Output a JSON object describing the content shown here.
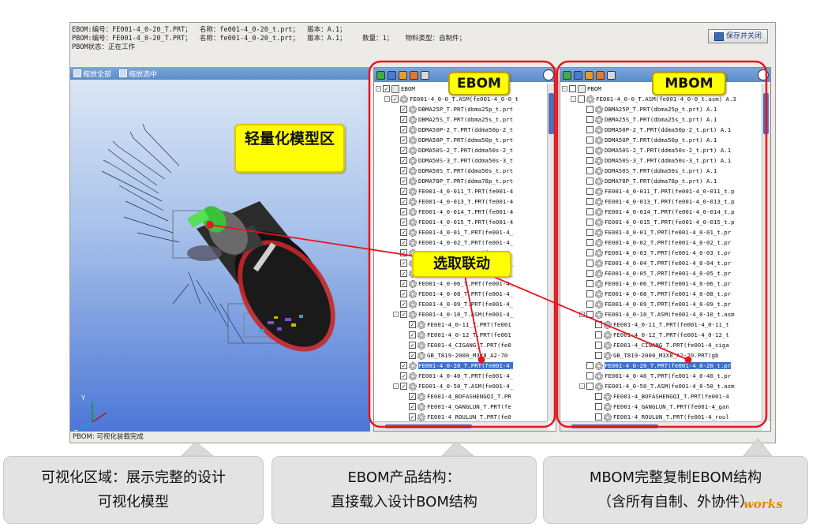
{
  "info": {
    "line1": "EBOM:编号：FE001-4_0-20_T.PRT；  名称：fe001-4_0-20_t.prt；  版本：A.1；",
    "line2": "PBOM:编号：FE001-4_0-20_T.PRT；  名称：fe001-4_0-20_t.prt；  版本：A.1；    数量：1；   物料类型：自制件；",
    "line3": "PBOM状态：正在工作",
    "save_button": "保存并关闭"
  },
  "viewer": {
    "zoom_all": "缩放全部",
    "zoom_selected": "缩放选中",
    "status": "PBOM: 可视化装载完成",
    "axis_y": "Y",
    "axis_z": "Z"
  },
  "callouts": {
    "model_area": "轻量化模型区",
    "ebom": "EBOM",
    "mbom": "MBOM",
    "selection_link": "选取联动"
  },
  "ebom_tree": [
    {
      "indent": 0,
      "exp": "-",
      "checked": true,
      "icon": "folder",
      "text": "EBOM"
    },
    {
      "indent": 1,
      "exp": "-",
      "checked": true,
      "icon": "gear",
      "text": "FE001-4_0-0_T.ASM(fe001-4_0-0_t"
    },
    {
      "indent": 2,
      "exp": "",
      "checked": true,
      "icon": "gear",
      "text": "DBMA25P_T.PRT(dbma25p_t.prt"
    },
    {
      "indent": 2,
      "exp": "",
      "checked": true,
      "icon": "gear",
      "text": "DBMA25S_T.PRT(dbma25s_t.prt"
    },
    {
      "indent": 2,
      "exp": "",
      "checked": true,
      "icon": "gear",
      "text": "DDMA50P-2_T.PRT(ddma50p-2_t"
    },
    {
      "indent": 2,
      "exp": "",
      "checked": true,
      "icon": "gear",
      "text": "DDMA50P_T.PRT(ddma50p_t.prt"
    },
    {
      "indent": 2,
      "exp": "",
      "checked": true,
      "icon": "gear",
      "text": "DDMA50S-2_T.PRT(ddma50s-2_t"
    },
    {
      "indent": 2,
      "exp": "",
      "checked": true,
      "icon": "gear",
      "text": "DDMA50S-3_T.PRT(ddma50s-3_t"
    },
    {
      "indent": 2,
      "exp": "",
      "checked": true,
      "icon": "gear",
      "text": "DDMA50S_T.PRT(ddma50s_t.prt"
    },
    {
      "indent": 2,
      "exp": "",
      "checked": true,
      "icon": "gear",
      "text": "DDMA78P_T.PRT(ddma78p_t.prt"
    },
    {
      "indent": 2,
      "exp": "",
      "checked": true,
      "icon": "gear",
      "text": "FE001-4_0-011_T.PRT(fe001-4"
    },
    {
      "indent": 2,
      "exp": "",
      "checked": true,
      "icon": "gear",
      "text": "FE001-4_0-013_T.PRT(fe001-4"
    },
    {
      "indent": 2,
      "exp": "",
      "checked": true,
      "icon": "gear",
      "text": "FE001-4_0-014_T.PRT(fe001-4"
    },
    {
      "indent": 2,
      "exp": "",
      "checked": true,
      "icon": "gear",
      "text": "FE001-4_0-015_T.PRT(fe001-4"
    },
    {
      "indent": 2,
      "exp": "",
      "checked": true,
      "icon": "gear",
      "text": "FE001-4_0-01_T.PRT(fe001-4_"
    },
    {
      "indent": 2,
      "exp": "",
      "checked": true,
      "icon": "gear",
      "text": "FE001-4_0-02_T.PRT(fe001-4_"
    },
    {
      "indent": 2,
      "exp": "",
      "checked": true,
      "icon": "gear",
      "text": "FE001-4_0-03_T.PRT(fe001-4_"
    },
    {
      "indent": 2,
      "exp": "",
      "checked": true,
      "icon": "gear",
      "text": "FE001-4_0-04_T.PRT(fe001-4_"
    },
    {
      "indent": 2,
      "exp": "",
      "checked": true,
      "icon": "gear",
      "text": "FE001-4_0-05_T.PRT(fe001-4_"
    },
    {
      "indent": 2,
      "exp": "",
      "checked": true,
      "icon": "gear",
      "text": "FE001-4_0-06_T.PRT(fe001-4_"
    },
    {
      "indent": 2,
      "exp": "",
      "checked": true,
      "icon": "gear",
      "text": "FE001-4_0-08_T.PRT(fe001-4_"
    },
    {
      "indent": 2,
      "exp": "",
      "checked": true,
      "icon": "gear",
      "text": "FE001-4_0-09_T.PRT(fe001-4_"
    },
    {
      "indent": 2,
      "exp": "-",
      "checked": true,
      "icon": "gear",
      "text": "FE001-4_0-10_T.ASM(fe001-4_"
    },
    {
      "indent": 3,
      "exp": "",
      "checked": true,
      "icon": "gear",
      "text": "FE001-4_0-11_T.PRT(fe001"
    },
    {
      "indent": 3,
      "exp": "",
      "checked": true,
      "icon": "gear",
      "text": "FE001-4_0-12_T.PRT(fe001"
    },
    {
      "indent": 3,
      "exp": "",
      "checked": true,
      "icon": "gear",
      "text": "FE001-4_CIGANG_T.PRT(fe0"
    },
    {
      "indent": 3,
      "exp": "",
      "checked": true,
      "icon": "gear",
      "text": "GB_T819-2000_M3X8_A2-70"
    },
    {
      "indent": 2,
      "exp": "",
      "checked": true,
      "icon": "gear",
      "text": "FE001-4_0-20_T.PRT(fe001-4_",
      "selected": true
    },
    {
      "indent": 2,
      "exp": "",
      "checked": true,
      "icon": "gear",
      "text": "FE001-4_0-40_T.PRT(fe001-4_"
    },
    {
      "indent": 2,
      "exp": "-",
      "checked": true,
      "icon": "gear",
      "text": "FE001-4_0-50_T.ASM(fe001-4_"
    },
    {
      "indent": 3,
      "exp": "",
      "checked": true,
      "icon": "gear",
      "text": "FE001-4_BOFASHENGQI_T.PR"
    },
    {
      "indent": 3,
      "exp": "",
      "checked": true,
      "icon": "gear",
      "text": "FE001-4_GANGLUN_T.PRT(fe"
    },
    {
      "indent": 3,
      "exp": "",
      "checked": true,
      "icon": "gear",
      "text": "FE001-4_ROULUN_T.PRT(fe0"
    }
  ],
  "mbom_tree": [
    {
      "indent": 0,
      "exp": "-",
      "checked": false,
      "icon": "folder",
      "text": "PBOM"
    },
    {
      "indent": 1,
      "exp": "-",
      "checked": false,
      "icon": "gear",
      "text": "FE001-4_0-0_T.ASM(fe001-4_0-0_t.asm) A.3"
    },
    {
      "indent": 2,
      "exp": "",
      "checked": false,
      "icon": "gear",
      "text": "DBMA25P_T.PRT(dbma25p_t.prt) A.1"
    },
    {
      "indent": 2,
      "exp": "",
      "checked": false,
      "icon": "gear",
      "text": "DBMA25S_T.PRT(dbma25s_t.prt) A.1"
    },
    {
      "indent": 2,
      "exp": "",
      "checked": false,
      "icon": "gear",
      "text": "DDMA50P-2_T.PRT(ddma50p-2_t.prt) A.1"
    },
    {
      "indent": 2,
      "exp": "",
      "checked": false,
      "icon": "gear",
      "text": "DDMA50P_T.PRT(ddma50p_t.prt) A.1"
    },
    {
      "indent": 2,
      "exp": "",
      "checked": false,
      "icon": "gear",
      "text": "DDMA50S-2_T.PRT(ddma50s-2_t.prt) A.1"
    },
    {
      "indent": 2,
      "exp": "",
      "checked": false,
      "icon": "gear",
      "text": "DDMA50S-3_T.PRT(ddma50s-3_t.prt) A.1"
    },
    {
      "indent": 2,
      "exp": "",
      "checked": false,
      "icon": "gear",
      "text": "DDMA50S_T.PRT(ddma50s_t.prt) A.1"
    },
    {
      "indent": 2,
      "exp": "",
      "checked": false,
      "icon": "gear",
      "text": "DDMA78P_T.PRT(ddma78p_t.prt) A.1"
    },
    {
      "indent": 2,
      "exp": "",
      "checked": false,
      "icon": "gear",
      "text": "FE001-4_0-011_T.PRT(fe001-4_0-011_t.p"
    },
    {
      "indent": 2,
      "exp": "",
      "checked": false,
      "icon": "gear",
      "text": "FE001-4_0-013_T.PRT(fe001-4_0-013_t.p"
    },
    {
      "indent": 2,
      "exp": "",
      "checked": false,
      "icon": "gear",
      "text": "FE001-4_0-014_T.PRT(fe001-4_0-014_t.p"
    },
    {
      "indent": 2,
      "exp": "",
      "checked": false,
      "icon": "gear",
      "text": "FE001-4_0-015_T.PRT(fe001-4_0-015_t.p"
    },
    {
      "indent": 2,
      "exp": "",
      "checked": false,
      "icon": "gear",
      "text": "FE001-4_0-01_T.PRT(fe001-4_0-01_t.pr"
    },
    {
      "indent": 2,
      "exp": "",
      "checked": false,
      "icon": "gear",
      "text": "FE001-4_0-02_T.PRT(fe001-4_0-02_t.pr"
    },
    {
      "indent": 2,
      "exp": "",
      "checked": false,
      "icon": "gear",
      "text": "FE001-4_0-03_T.PRT(fe001-4_0-03_t.pr"
    },
    {
      "indent": 2,
      "exp": "",
      "checked": false,
      "icon": "gear",
      "text": "FE001-4_0-04_T.PRT(fe001-4_0-04_t.pr"
    },
    {
      "indent": 2,
      "exp": "",
      "checked": false,
      "icon": "gear",
      "text": "FE001-4_0-05_T.PRT(fe001-4_0-05_t.pr"
    },
    {
      "indent": 2,
      "exp": "",
      "checked": false,
      "icon": "gear",
      "text": "FE001-4_0-06_T.PRT(fe001-4_0-06_t.pr"
    },
    {
      "indent": 2,
      "exp": "",
      "checked": false,
      "icon": "gear",
      "text": "FE001-4_0-08_T.PRT(fe001-4_0-08_t.pr"
    },
    {
      "indent": 2,
      "exp": "",
      "checked": false,
      "icon": "gear",
      "text": "FE001-4_0-09_T.PRT(fe001-4_0-09_t.pr"
    },
    {
      "indent": 2,
      "exp": "-",
      "checked": false,
      "icon": "gear",
      "text": "FE001-4_0-10_T.ASM(fe001-4_0-10_t.asm"
    },
    {
      "indent": 3,
      "exp": "",
      "checked": false,
      "icon": "gear",
      "text": "FE001-4_0-11_T.PRT(fe001-4_0-11_t"
    },
    {
      "indent": 3,
      "exp": "",
      "checked": false,
      "icon": "gear",
      "text": "FE001-4_0-12_T.PRT(fe001-4_0-12_t"
    },
    {
      "indent": 3,
      "exp": "",
      "checked": false,
      "icon": "gear",
      "text": "FE001-4_CIGANG_T.PRT(fe001-4_ciga"
    },
    {
      "indent": 3,
      "exp": "",
      "checked": false,
      "icon": "gear",
      "text": "GB_T819-2000_M3X8_A2-70.PRT(gb"
    },
    {
      "indent": 2,
      "exp": "",
      "checked": false,
      "icon": "gear",
      "text": "FE001-4_0-20_T.PRT(fe001-4_0-20_t.pr",
      "selected": true
    },
    {
      "indent": 2,
      "exp": "",
      "checked": false,
      "icon": "gear",
      "text": "FE001-4_0-40_T.PRT(fe001-4_0-40_t.pr"
    },
    {
      "indent": 2,
      "exp": "-",
      "checked": false,
      "icon": "gear",
      "text": "FE001-4_0-50_T.ASM(fe001-4_0-50_t.asm"
    },
    {
      "indent": 3,
      "exp": "",
      "checked": false,
      "icon": "gear",
      "text": "FE001-4_BOFASHENGQI_T.PRT(fe001-4"
    },
    {
      "indent": 3,
      "exp": "",
      "checked": false,
      "icon": "gear",
      "text": "FE001-4_GANGLUN_T.PRT(fe001-4_gan"
    },
    {
      "indent": 3,
      "exp": "",
      "checked": false,
      "icon": "gear",
      "text": "FE001-4_ROULUN_T.PRT(fe001-4_roul"
    }
  ],
  "captions": {
    "c1_l1": "可视化区域：展示完整的设计",
    "c1_l2": "可视化模型",
    "c2_l1": "EBOM产品结构：",
    "c2_l2": "直接载入设计BOM结构",
    "c3_l1": "MBOM完整复制EBOM结构",
    "c3_l2": "（含所有自制、外协件）"
  },
  "logo": "works",
  "colors": {
    "highlight_red": "#e8141e",
    "callout_yellow": "#ffff00",
    "toolbar_blue": "#5b8ccb",
    "selection_blue": "#3a73c9"
  }
}
